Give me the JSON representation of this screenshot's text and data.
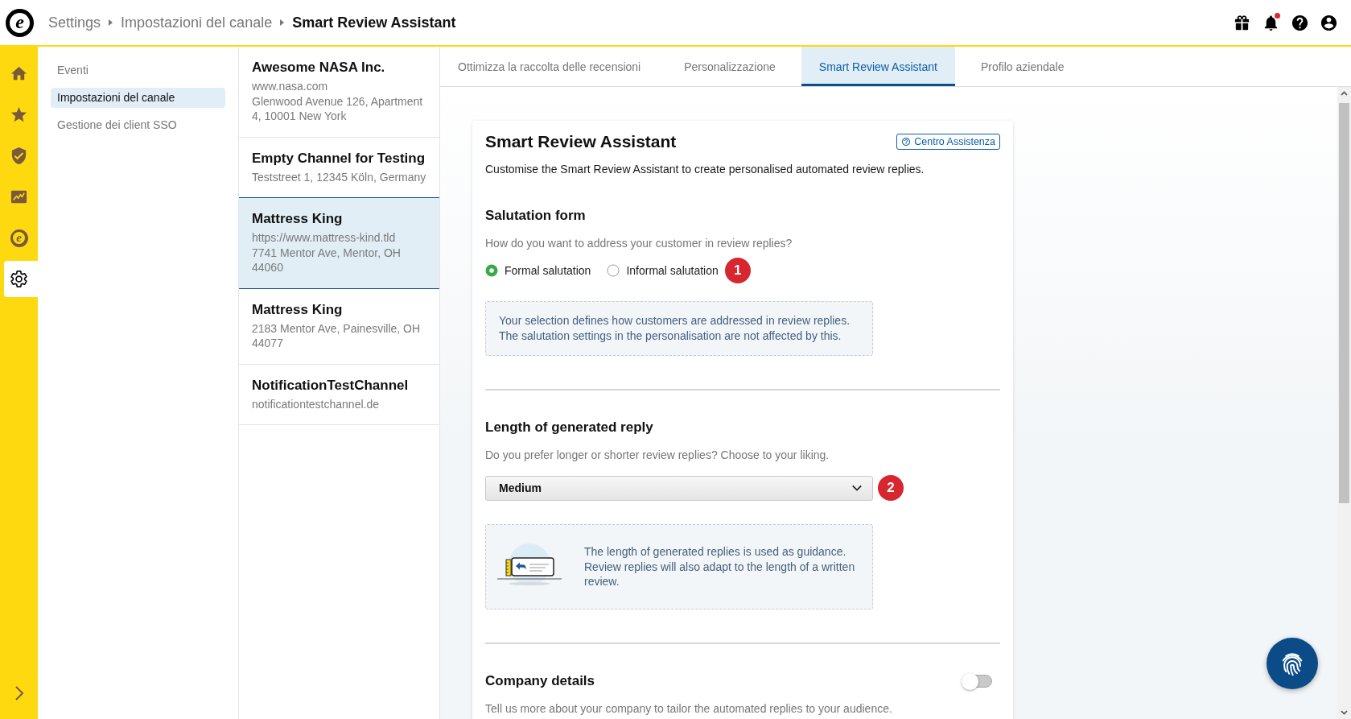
{
  "header": {
    "logo": "e",
    "breadcrumb": [
      "Settings",
      "Impostazioni del canale",
      "Smart Review Assistant"
    ],
    "bell_unread": true
  },
  "rail": {
    "items": [
      {
        "kind": "home",
        "selected": false
      },
      {
        "kind": "star",
        "selected": false
      },
      {
        "kind": "shield",
        "selected": false
      },
      {
        "kind": "chart",
        "selected": false
      },
      {
        "kind": "brand",
        "glyph": "e",
        "selected": false
      },
      {
        "kind": "settings",
        "selected": true
      }
    ]
  },
  "nav": {
    "items": [
      {
        "label": "Eventi",
        "selected": false
      },
      {
        "label": "Impostazioni del canale",
        "selected": true
      },
      {
        "label": "Gestione dei client SSO",
        "selected": false
      }
    ]
  },
  "channels": [
    {
      "name": "Awesome NASA Inc.",
      "details": [
        "www.nasa.com",
        "Glenwood Avenue 126, Apartment 4, 10001 New York"
      ],
      "selected": false
    },
    {
      "name": "Empty Channel for Testing",
      "details": [
        "Teststreet 1, 12345 Köln, Germany"
      ],
      "selected": false
    },
    {
      "name": "Mattress King",
      "details": [
        "https://www.mattress-kind.tld",
        "7741 Mentor Ave, Mentor, OH 44060"
      ],
      "selected": true
    },
    {
      "name": "Mattress King",
      "details": [
        "2183 Mentor Ave, Painesville, OH 44077"
      ],
      "selected": false
    },
    {
      "name": "NotificationTestChannel",
      "details": [
        "notificationtestchannel.de"
      ],
      "selected": false
    }
  ],
  "tabs": [
    {
      "label": "Ottimizza la raccolta delle recensioni",
      "selected": false
    },
    {
      "label": "Personalizzazione",
      "selected": false
    },
    {
      "label": "Smart Review Assistant",
      "selected": true
    },
    {
      "label": "Profilo aziendale",
      "selected": false
    }
  ],
  "card": {
    "title": "Smart Review Assistant",
    "help_link": "Centro Assistenza",
    "description": "Customise the Smart Review Assistant to create personalised automated review replies.",
    "sections": [
      {
        "kind": "radio",
        "title": "Salutation form",
        "question": "How do you want to address your customer in review replies?",
        "options": [
          {
            "label": "Formal salutation",
            "selected": true
          },
          {
            "label": "Informal salutation",
            "selected": false
          }
        ],
        "badge": "1",
        "info": "Your selection defines how customers are addressed in review replies. The salutation settings in the personalisation are not affected by this."
      },
      {
        "kind": "select",
        "title": "Length of generated reply",
        "question": "Do you prefer longer or shorter review replies? Choose to your liking.",
        "value": "Medium",
        "badge": "2",
        "info": "The length of generated replies is used as guidance. Review replies will also adapt to the length of a written review.",
        "info_illustration": true
      },
      {
        "kind": "toggle",
        "title": "Company details",
        "on": false,
        "question": "Tell us more about your company to tailor the automated replies to your audience."
      }
    ]
  }
}
